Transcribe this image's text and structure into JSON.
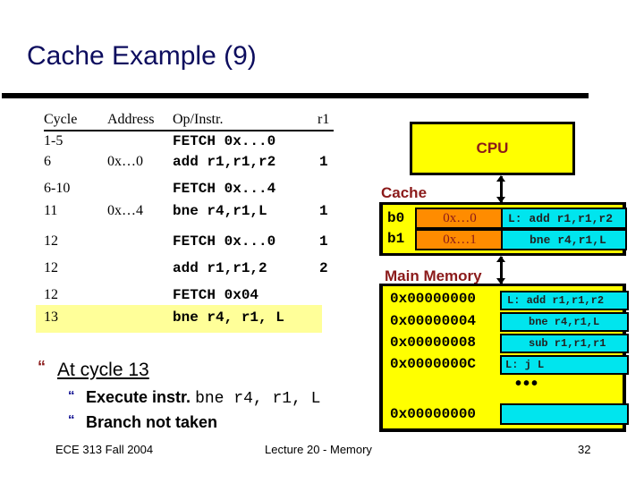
{
  "slide": {
    "title": "Cache Example (9)",
    "footer": {
      "left": "ECE 313 Fall 2004",
      "center": "Lecture 20 - Memory",
      "page": "32"
    }
  },
  "table": {
    "headers": {
      "cycle": "Cycle",
      "address": "Address",
      "op": "Op/Instr.",
      "r1": "r1"
    },
    "rows": [
      {
        "cycle": "1-5",
        "address": "",
        "op": "FETCH 0x...0",
        "r1": ""
      },
      {
        "cycle": "6",
        "address": "0x…0",
        "op": "add r1,r1,r2",
        "r1": "1"
      },
      {
        "cycle": "6-10",
        "address": "",
        "op": "FETCH 0x...4",
        "r1": ""
      },
      {
        "cycle": "11",
        "address": "0x…4",
        "op": "bne r4,r1,L",
        "r1": "1"
      },
      {
        "cycle": "12",
        "address": "",
        "op": "FETCH 0x...0",
        "r1": "1"
      },
      {
        "cycle": "12",
        "address": "",
        "op": "add r1,r1,2",
        "r1": "2"
      },
      {
        "cycle": "12",
        "address": "",
        "op": "FETCH 0x04",
        "r1": ""
      },
      {
        "cycle": "13",
        "address": "",
        "op": "bne r4, r1, L",
        "r1": "",
        "highlighted": true
      }
    ]
  },
  "bullets": {
    "main": "At cycle 13",
    "sub": [
      {
        "prefix": "Execute instr. ",
        "code": "bne r4, r1, L"
      },
      {
        "prefix": "Branch not taken",
        "code": ""
      }
    ],
    "icon": "quote-bullet-icon"
  },
  "diagram": {
    "cpu_label": "CPU",
    "cache_label": "Cache",
    "memory_label": "Main Memory",
    "cache_blocks": [
      {
        "block": "b0",
        "tag": "0x…0",
        "data": "L: add r1,r1,r2"
      },
      {
        "block": "b1",
        "tag": "0x…1",
        "data": "bne r4,r1,L"
      }
    ],
    "memory_rows": [
      {
        "address": "0x00000000",
        "data": "L: add r1,r1,r2"
      },
      {
        "address": "0x00000004",
        "data": "bne r4,r1,L"
      },
      {
        "address": "0x00000008",
        "data": "sub r1,r1,r1"
      },
      {
        "address": "0x0000000C",
        "data": "L: j L"
      },
      {
        "address": "0x00000000",
        "data": ""
      }
    ],
    "ellipsis": "•••",
    "colors": {
      "yellow": "#ffff00",
      "orange": "#ff8c00",
      "cyan": "#00e5ee",
      "label_red": "#8b1a1a",
      "highlight": "#ffff99",
      "title_navy": "#0d0d5e"
    }
  }
}
